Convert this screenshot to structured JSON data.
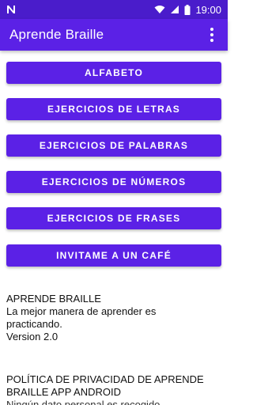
{
  "status_bar": {
    "time": "19:00",
    "notification_icon": "n-letter-icon",
    "icons": [
      "wifi-icon",
      "signal-icon",
      "battery-icon"
    ]
  },
  "app_bar": {
    "title": "Aprende Braille",
    "menu_icon": "more-vert-icon"
  },
  "colors": {
    "primary": "#5b21e6",
    "primary_dark": "#4a1ccb",
    "text": "#111111",
    "background": "#ffffff"
  },
  "buttons": [
    {
      "label": "ALFABETO"
    },
    {
      "label": "EJERCICIOS DE LETRAS"
    },
    {
      "label": "EJERCICIOS DE PALABRAS"
    },
    {
      "label": "EJERCICIOS DE NÚMEROS"
    },
    {
      "label": "EJERCICIOS DE FRASES"
    },
    {
      "label": "INVITAME A UN CAFÉ"
    }
  ],
  "about": {
    "title": "APRENDE BRAILLE",
    "line1": "La mejor manera de aprender es",
    "line2": "practicando.",
    "version": "Version 2.0"
  },
  "privacy": {
    "line1": "POLÍTICA DE PRIVACIDAD DE APRENDE",
    "line2": "BRAILLE APP ANDROID",
    "line3": "Ningún dato personal es recogido"
  }
}
